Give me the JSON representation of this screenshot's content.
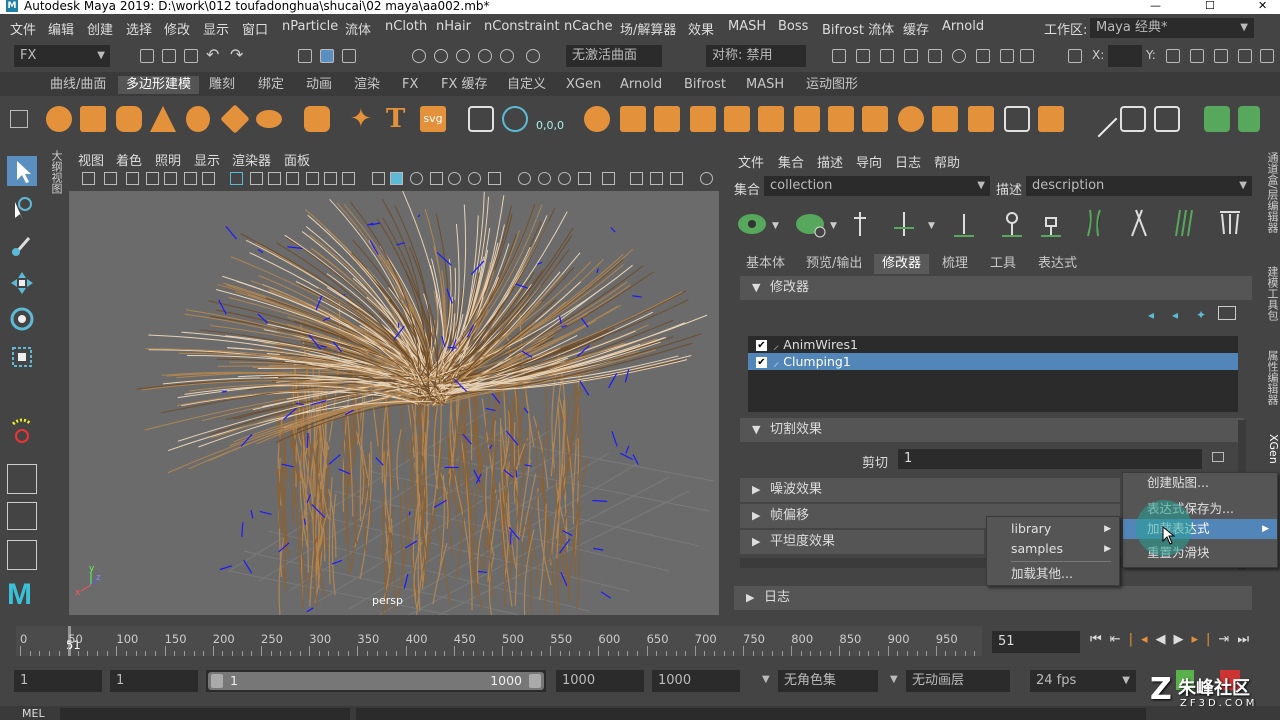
{
  "window": {
    "title": "Autodesk Maya 2019: D:\\work\\012 toufadonghua\\shucai\\02 maya\\aa002.mb*",
    "logo_letter": "M"
  },
  "menubar": {
    "items": [
      "文件",
      "编辑",
      "创建",
      "选择",
      "修改",
      "显示",
      "窗口",
      "nParticle",
      "流体",
      "nCloth",
      "nHair",
      "nConstraint",
      "nCache",
      "场/解算器",
      "效果",
      "MASH",
      "Boss",
      "Bifrost 流体",
      "缓存",
      "Arnold"
    ],
    "workspace_label": "工作区:",
    "workspace_value": "Maya 经典*"
  },
  "statusline": {
    "mode": "FX",
    "live_surface": "无激活曲面",
    "symmetry": "对称: 禁用",
    "x_label": "X:",
    "y_label": "Y:"
  },
  "shelf": {
    "tabs": [
      "曲线/曲面",
      "多边形建模",
      "雕刻",
      "绑定",
      "动画",
      "渲染",
      "FX",
      "FX 缓存",
      "自定义",
      "XGen",
      "Arnold",
      "Bifrost",
      "MASH",
      "运动图形"
    ],
    "active_tab": 1,
    "text_icon": "T",
    "svg_icon": "svg",
    "coords_icon": "0,0,0"
  },
  "left_sidetab": "大纲视图",
  "viewport": {
    "menu": [
      "视图",
      "着色",
      "照明",
      "显示",
      "渲染器",
      "面板"
    ],
    "camera_label": "persp",
    "axis_y": "y",
    "axis_x": "x",
    "axis_z": "z"
  },
  "xgen": {
    "menu": [
      "文件",
      "集合",
      "描述",
      "导向",
      "日志",
      "帮助"
    ],
    "collection_label": "集合",
    "collection_value": "collection",
    "description_label": "描述",
    "description_value": "description",
    "tabs": [
      "基本体",
      "预览/输出",
      "修改器",
      "梳理",
      "工具",
      "表达式"
    ],
    "active_tab": 2,
    "modifiers_section": "修改器",
    "modifiers": [
      {
        "name": "AnimWires1",
        "checked": true,
        "selected": false
      },
      {
        "name": "Clumping1",
        "checked": true,
        "selected": true
      }
    ],
    "cut_section": "切割效果",
    "cut_label": "剪切",
    "cut_value": "1",
    "noise_section": "噪波效果",
    "offset_section": "帧偏移",
    "flatness_section": "平坦度效果",
    "log_section": "日志"
  },
  "context_menu": {
    "items": [
      "创建贴图...",
      "表达式保存为...",
      "加载表达式",
      "重置为滑块"
    ],
    "highlighted": 2
  },
  "submenu": {
    "items": [
      "library",
      "samples",
      "加载其他..."
    ]
  },
  "right_vtabs": [
    "通道盒/层编辑器",
    "建模工具包",
    "属性编辑器",
    "XGen"
  ],
  "timeslider": {
    "ticks": [
      "0",
      "50",
      "100",
      "150",
      "200",
      "250",
      "300",
      "350",
      "400",
      "450",
      "500",
      "550",
      "600",
      "650",
      "700",
      "750",
      "800",
      "850",
      "900",
      "950"
    ],
    "current_frame_marker": "51",
    "current_frame": "51"
  },
  "range": {
    "start": "1",
    "playback_start": "1",
    "slider_start": "1",
    "slider_end": "1000",
    "playback_end": "1000",
    "end": "1000",
    "character_set": "无角色集",
    "anim_layer": "无动画层",
    "fps": "24 fps"
  },
  "cmdline": {
    "label": "MEL"
  },
  "watermark": {
    "name": "朱峰社区",
    "url": "ZF3D.COM"
  },
  "colors": {
    "accent_blue": "#5285b8",
    "shelf_orange": "#e3913a",
    "hair_base": "#b08552",
    "guide_blue": "#1a1aff"
  }
}
